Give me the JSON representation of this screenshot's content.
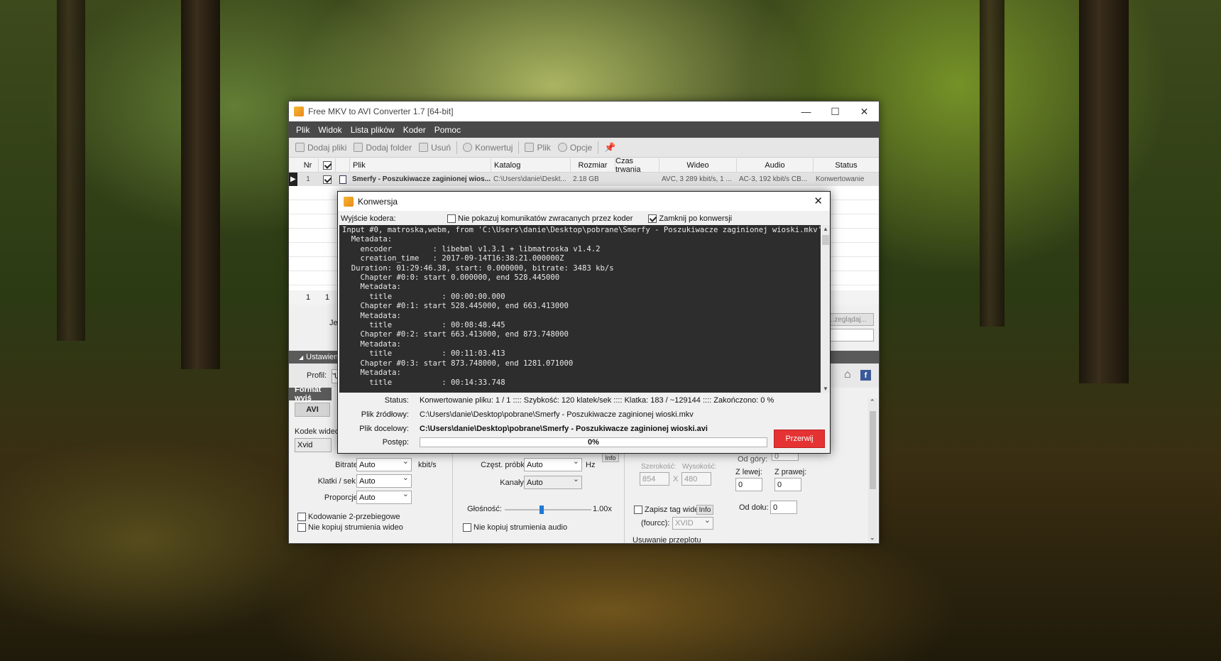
{
  "main_window": {
    "title": "Free MKV to AVI Converter 1.7  [64-bit]",
    "menu": [
      "Plik",
      "Widok",
      "Lista plików",
      "Koder",
      "Pomoc"
    ],
    "toolbar": {
      "add_files": "Dodaj pliki",
      "add_folder": "Dodaj folder",
      "remove": "Usuń",
      "convert": "Konwertuj",
      "file": "Plik",
      "options": "Opcje"
    },
    "grid": {
      "headers": [
        "Nr",
        "",
        "Plik",
        "Katalog",
        "Rozmiar",
        "Czas trwania",
        "Wideo",
        "Audio",
        "Status"
      ],
      "row": {
        "nr": "1",
        "file": "Smerfy - Poszukiwacze zaginionej wios...",
        "folder": "C:\\Users\\danie\\Deskt...",
        "size": "2.18 GB",
        "duration": "",
        "video": "AVC, 3 289 kbit/s, 1 ...",
        "audio": "AC-3, 192 kbit/s CB...",
        "status": "Konwertowanie"
      },
      "footer_count": "1",
      "footer_checked": "1"
    },
    "lower": {
      "partial_label_je": "Je",
      "browse_btn": "...zeglądaj...",
      "settings_tab": "Ustawienia",
      "profile_label": "Profil:",
      "profile_value": "U",
      "format_section": "Format wyjś",
      "avi_tab": "AVI",
      "video_codec_label": "Kodek wideo",
      "video_codec_value": "Xvid",
      "bitrate_label": "Bitrate:",
      "bitrate_value": "Auto",
      "bitrate_unit": "kbit/s",
      "fps_label": "Klatki / sek.:",
      "fps_value": "Auto",
      "ratio_label": "Proporcje:",
      "ratio_value": "Auto",
      "two_pass": "Kodowanie 2-przebiegowe",
      "no_copy_video": "Nie kopiuj strumienia wideo",
      "samplerate_label": "Częst. próbk.:",
      "samplerate_value": "Auto",
      "samplerate_unit": "Hz",
      "info_btn": "Info",
      "channels_label": "Kanały:",
      "channels_value": "Auto",
      "volume_label": "Głośność:",
      "volume_value": "1.00x",
      "volume_level": 0.42,
      "no_copy_audio": "Nie kopiuj strumienia audio",
      "width_label": "Szerokość:",
      "height_label": "Wysokość:",
      "width_value": "854",
      "height_value": "480",
      "x_sep": "X",
      "top_label": "Od góry:",
      "top_value": "0",
      "left_label": "Z lewej:",
      "left_value": "0",
      "right_label": "Z prawej:",
      "right_value": "0",
      "bottom_label": "Od dołu:",
      "bottom_value": "0",
      "save_tag": "Zapisz tag wide",
      "fourcc_label": "(fourcc):",
      "fourcc_value": "XVID",
      "deinterlace": "Usuwanie przeplotu"
    }
  },
  "dialog": {
    "title": "Konwersja",
    "encoder_output_label": "Wyjście kodera:",
    "hide_messages": "Nie pokazuj komunikatów zwracanych przez koder",
    "close_after": "Zamknij po konwersji",
    "console_lines": [
      "Input #0, matroska,webm, from 'C:\\Users\\danie\\Desktop\\pobrane\\Smerfy - Poszukiwacze zaginionej wioski.mkv':",
      "  Metadata:",
      "    encoder         : libebml v1.3.1 + libmatroska v1.4.2",
      "    creation_time   : 2017-09-14T16:38:21.000000Z",
      "  Duration: 01:29:46.38, start: 0.000000, bitrate: 3483 kb/s",
      "    Chapter #0:0: start 0.000000, end 528.445000",
      "    Metadata:",
      "      title           : 00:00:00.000",
      "    Chapter #0:1: start 528.445000, end 663.413000",
      "    Metadata:",
      "      title           : 00:08:48.445",
      "    Chapter #0:2: start 663.413000, end 873.748000",
      "    Metadata:",
      "      title           : 00:11:03.413",
      "    Chapter #0:3: start 873.748000, end 1281.071000",
      "    Metadata:",
      "      title           : 00:14:33.748"
    ],
    "status_label": "Status:",
    "status_value": "Konwertowanie pliku: 1 / 1  ::::  Szybkość: 120 klatek/sek  ::::  Klatka: 183 / ~129144  ::::  Zakończono: 0 %",
    "source_label": "Plik źródłowy:",
    "source_value": "C:\\Users\\danie\\Desktop\\pobrane\\Smerfy - Poszukiwacze zaginionej wioski.mkv",
    "target_label": "Plik docelowy:",
    "target_value": "C:\\Users\\danie\\Desktop\\pobrane\\Smerfy - Poszukiwacze zaginionej wioski.avi",
    "progress_label": "Postęp:",
    "progress_text": "0%",
    "progress_value": 0,
    "stop_button": "Przerwij"
  }
}
